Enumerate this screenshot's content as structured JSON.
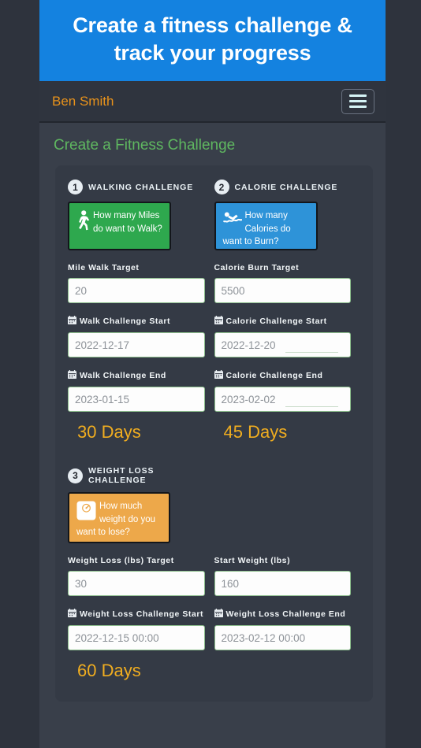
{
  "hero": {
    "title": "Create a fitness challenge & track your progress"
  },
  "navbar": {
    "brand": "Ben Smith",
    "menu_icon": "hamburger-menu-icon",
    "menu_label": "Menu"
  },
  "page": {
    "title": "Create a Fitness Challenge"
  },
  "colors": {
    "accent_blue": "#1482e0",
    "brand_orange": "#e8921b",
    "heading_green": "#5fb760",
    "days_amber": "#f0ad20",
    "tile_green": "#2ea84e",
    "tile_blue": "#2e93d8",
    "tile_amber": "#eda84a",
    "page_bg": "#393f4a",
    "card_bg": "#343a45",
    "frame_bg": "#2e333d"
  },
  "challenges": [
    {
      "number": "1",
      "name": "WALKING CHALLENGE",
      "tile": {
        "icon": "walking-person-icon",
        "line1": "How many Miles",
        "line2": "do want to Walk?",
        "color": "#2ea84e"
      },
      "target": {
        "label": "Mile Walk Target",
        "value": "20",
        "placeholder": "20"
      },
      "start": {
        "label": "Walk Challenge Start",
        "icon": "calendar-icon",
        "value": "2022-12-17",
        "placeholder": "2022-12-17"
      },
      "end": {
        "label": "Walk Challenge End",
        "icon": "calendar-icon",
        "value": "2023-01-15",
        "placeholder": "2023-01-15"
      },
      "duration": "30 Days"
    },
    {
      "number": "2",
      "name": "CALORIE CHALLENGE",
      "tile": {
        "icon": "swimmer-icon",
        "line1": "How many Calories",
        "line2": "do want to Burn?",
        "color": "#2e93d8"
      },
      "target": {
        "label": "Calorie Burn Target",
        "value": "5500",
        "placeholder": "5500"
      },
      "start": {
        "label": "Calorie Challenge Start",
        "icon": "calendar-icon",
        "value": "2022-12-20",
        "placeholder": "2022-12-20"
      },
      "end": {
        "label": "Calorie Challenge End",
        "icon": "calendar-icon",
        "value": "2023-02-02",
        "placeholder": "2023-02-02"
      },
      "duration": "45 Days"
    },
    {
      "number": "3",
      "name": "WEIGHT LOSS CHALLENGE",
      "tile": {
        "icon": "weight-scale-icon",
        "line1": "How much weight",
        "line2": "do you want to lose?",
        "color": "#eda84a"
      },
      "target": {
        "label": "Weight Loss (lbs) Target",
        "value": "30",
        "placeholder": "30"
      },
      "start_weight": {
        "label": "Start Weight (lbs)",
        "value": "160",
        "placeholder": "160"
      },
      "start": {
        "label": "Weight Loss Challenge Start",
        "icon": "calendar-icon",
        "value": "2022-12-15 00:00",
        "placeholder": "2022-12-15 00:00"
      },
      "end": {
        "label": "Weight Loss Challenge End",
        "icon": "calendar-icon",
        "value": "2023-02-12 00:00",
        "placeholder": "2023-02-12 00:00"
      },
      "duration": "60 Days"
    }
  ]
}
